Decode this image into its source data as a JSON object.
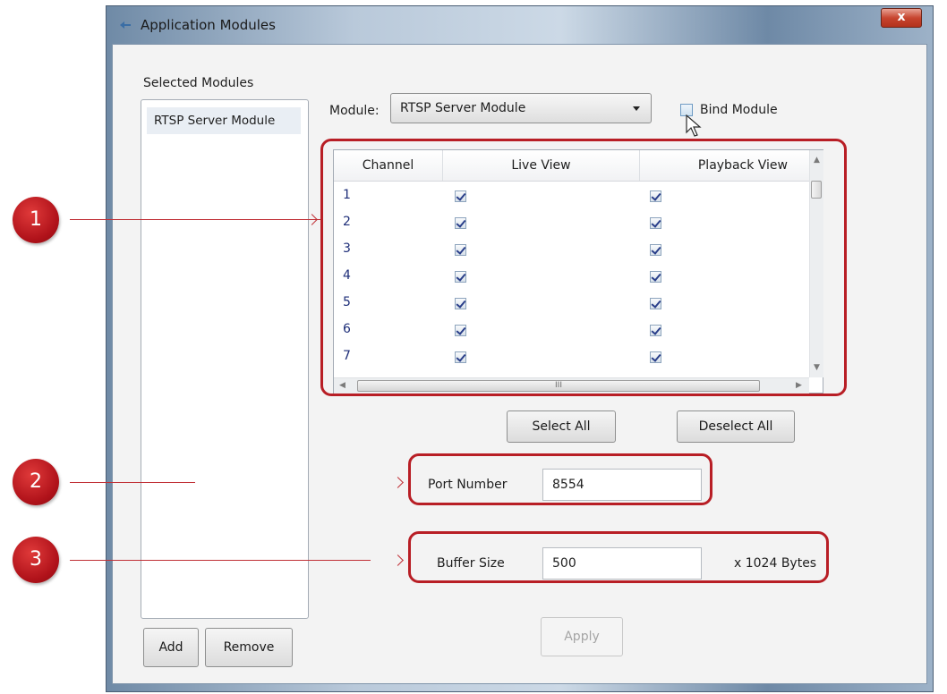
{
  "window": {
    "title": "Application Modules",
    "close_glyph": "x"
  },
  "selected_modules": {
    "label": "Selected Modules",
    "items": [
      "RTSP Server Module"
    ],
    "add_label": "Add",
    "remove_label": "Remove"
  },
  "module_row": {
    "label": "Module:",
    "selected": "RTSP Server Module",
    "bind_label": "Bind Module",
    "bind_checked": false
  },
  "channel_grid": {
    "columns": [
      "Channel",
      "Live View",
      "Playback View"
    ],
    "rows": [
      {
        "channel": "1",
        "live": true,
        "playback": true
      },
      {
        "channel": "2",
        "live": true,
        "playback": true
      },
      {
        "channel": "3",
        "live": true,
        "playback": true
      },
      {
        "channel": "4",
        "live": true,
        "playback": true
      },
      {
        "channel": "5",
        "live": true,
        "playback": true
      },
      {
        "channel": "6",
        "live": true,
        "playback": true
      },
      {
        "channel": "7",
        "live": true,
        "playback": true
      }
    ],
    "hscroll_grip": "III"
  },
  "actions": {
    "select_all": "Select All",
    "deselect_all": "Deselect All",
    "apply": "Apply"
  },
  "port": {
    "label": "Port Number",
    "value": "8554"
  },
  "buffer": {
    "label": "Buffer Size",
    "value": "500",
    "unit": "x 1024 Bytes"
  },
  "annotations": [
    "1",
    "2",
    "3"
  ],
  "colors": {
    "annotation_red": "#b81e25",
    "title_gradient_start": "#6f8aa6",
    "client_bg": "#f3f3f3"
  }
}
